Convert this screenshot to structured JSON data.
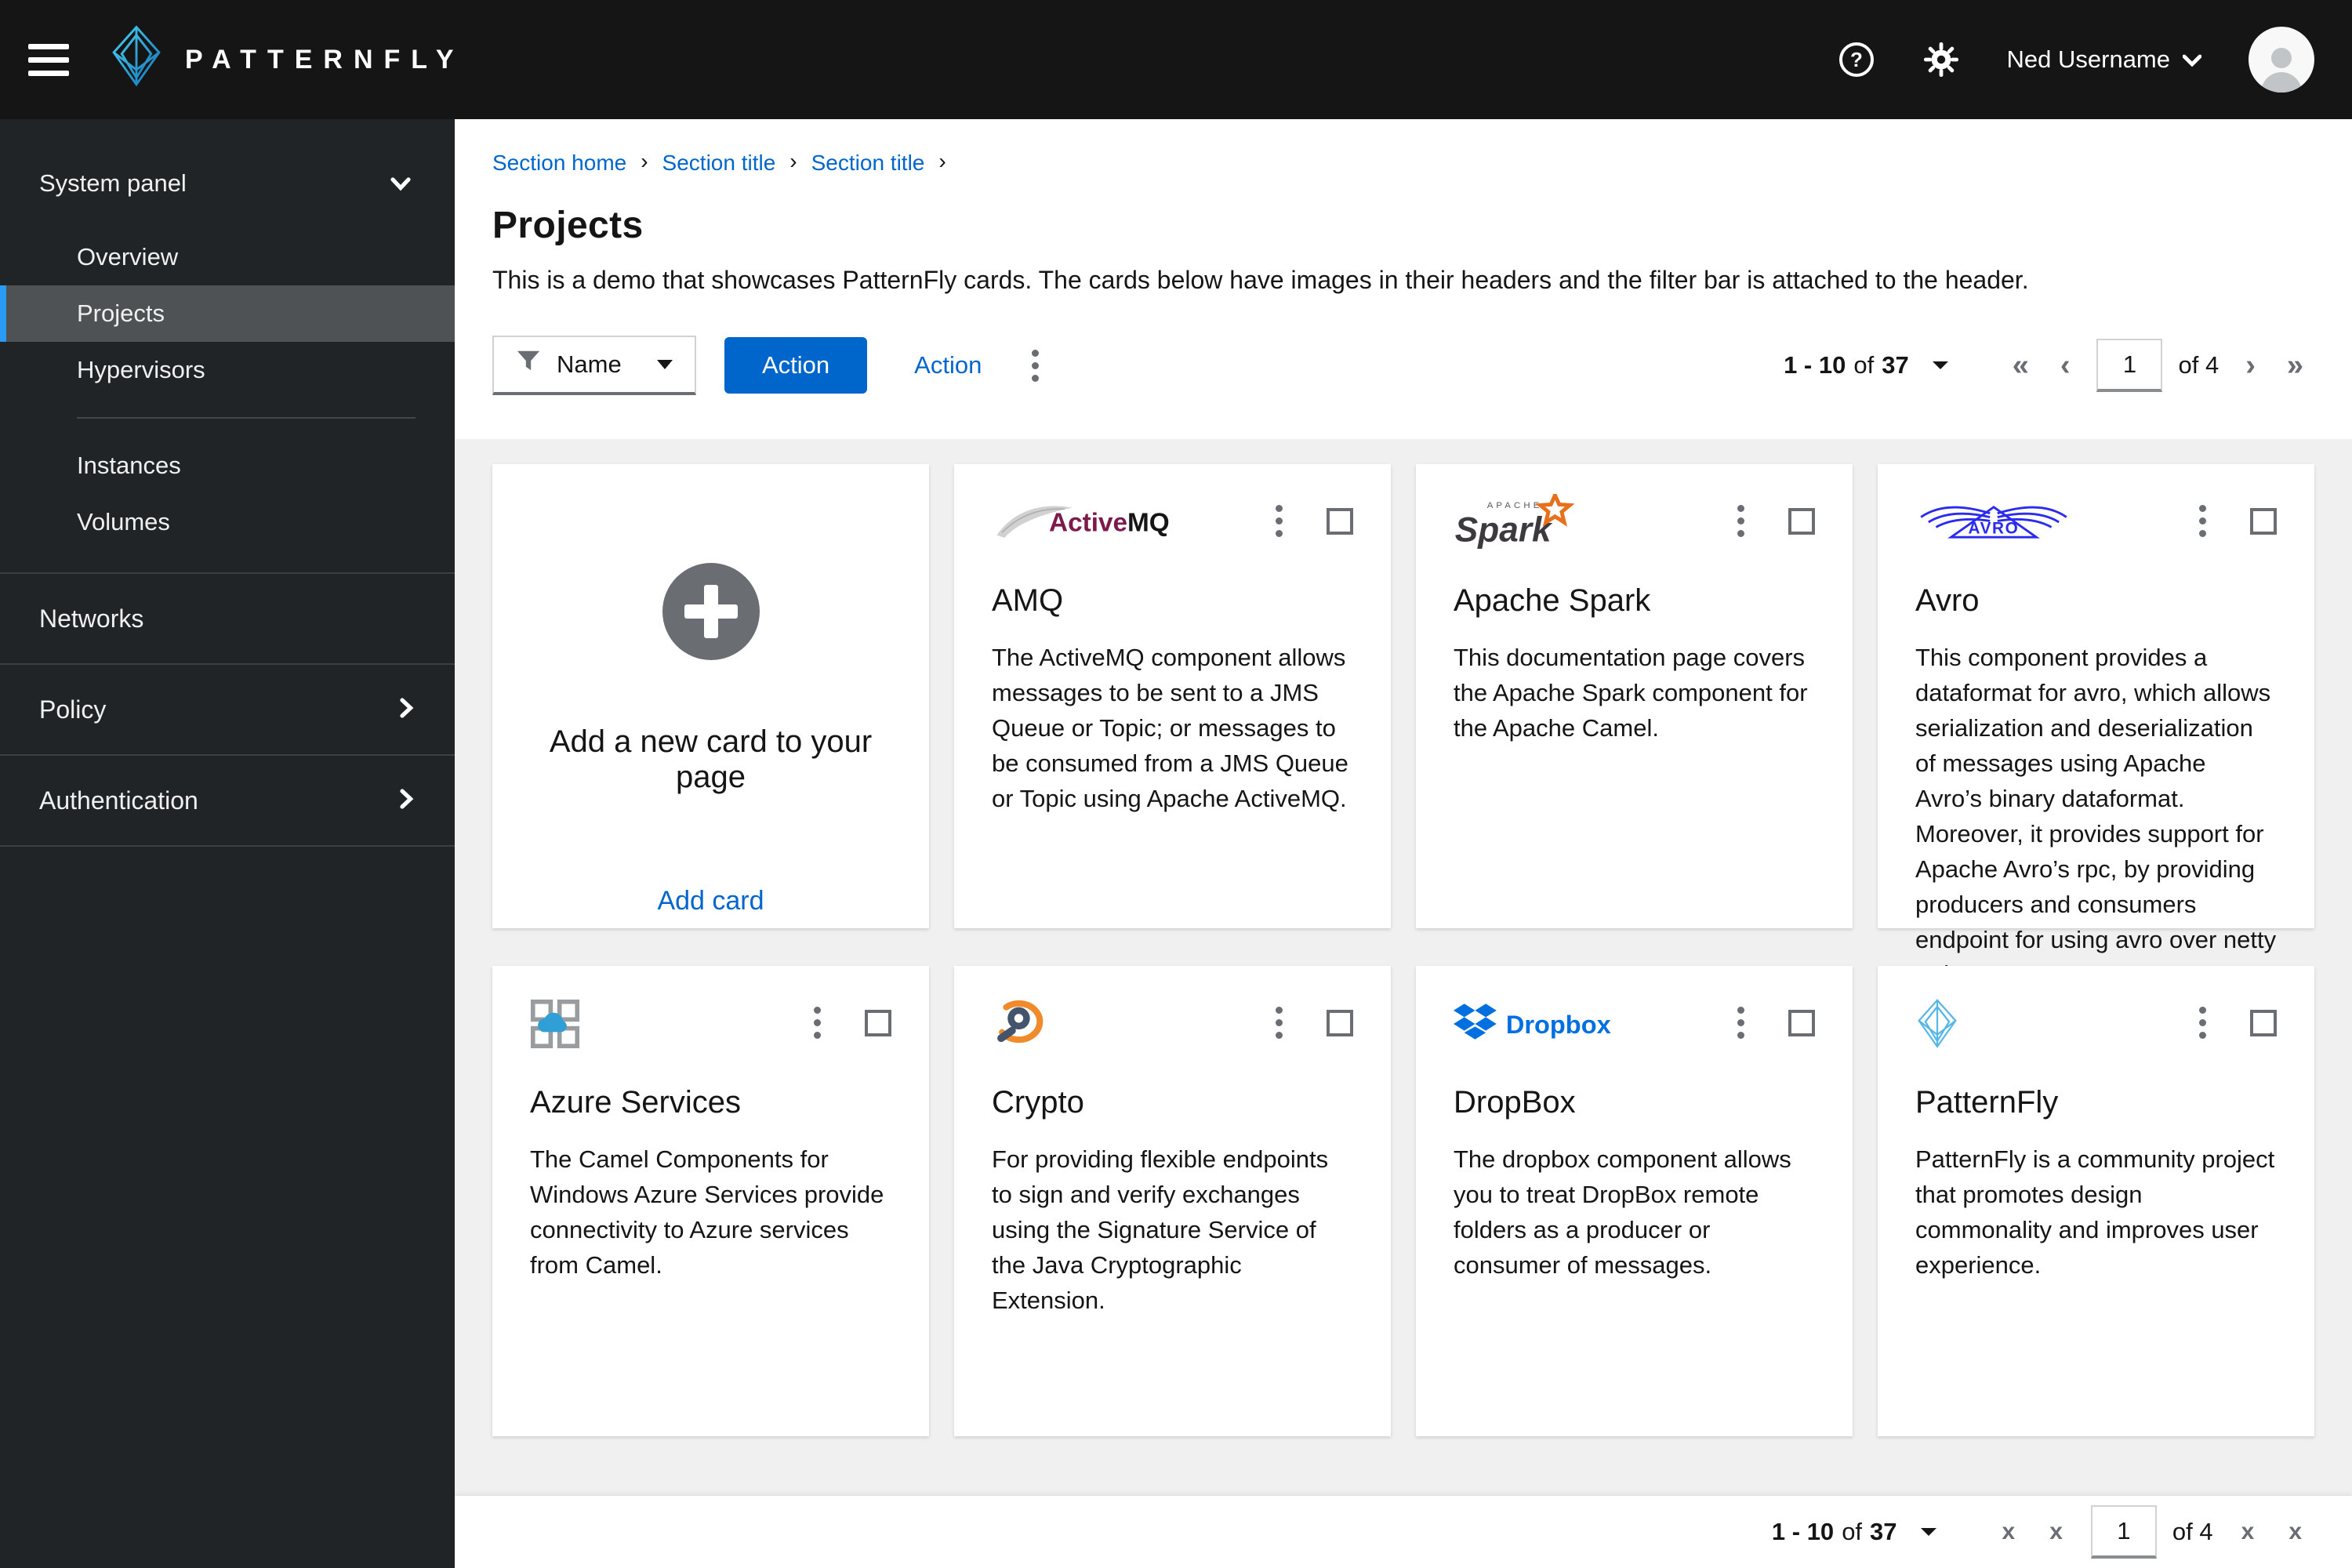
{
  "masthead": {
    "brand": "PATTERNFLY",
    "help_icon": "question-circle-icon",
    "settings_icon": "gear-icon",
    "user_name": "Ned Username"
  },
  "sidebar": {
    "section_label": "System panel",
    "items_group1": [
      {
        "label": "Overview",
        "selected": false
      },
      {
        "label": "Projects",
        "selected": true
      },
      {
        "label": "Hypervisors",
        "selected": false
      }
    ],
    "items_group2": [
      {
        "label": "Instances"
      },
      {
        "label": "Volumes"
      }
    ],
    "top_level": [
      {
        "label": "Networks",
        "expandable": false
      },
      {
        "label": "Policy",
        "expandable": true
      },
      {
        "label": "Authentication",
        "expandable": true
      }
    ]
  },
  "breadcrumb": {
    "items": [
      "Section home",
      "Section title",
      "Section title"
    ],
    "separator": "›"
  },
  "page": {
    "title": "Projects",
    "description": "This is a demo that showcases PatternFly cards. The cards below have images in their headers and the filter bar is attached to the header."
  },
  "toolbar": {
    "filter_label": "Name",
    "filter_icon": "funnel-icon",
    "primary_action_label": "Action",
    "link_action_label": "Action",
    "kebab_icon": "kebab-menu-icon"
  },
  "pagination": {
    "range": "1 - 10",
    "of_label": "of",
    "total": "37",
    "page_value": "1",
    "pages_label": "of 4",
    "first_glyph": "«",
    "prev_glyph": "‹",
    "next_glyph": "›",
    "last_glyph": "»",
    "broken_icon_glyph": "x"
  },
  "add_card": {
    "icon": "plus-circle-icon",
    "title": "Add a new card to your page",
    "link_label": "Add card"
  },
  "cards": {
    "items": [
      {
        "logo": "activemq-logo",
        "title": "AMQ",
        "description": "The ActiveMQ component allows messages to be sent to a JMS Queue or Topic; or messages to be consumed from a JMS Queue or Topic using Apache ActiveMQ."
      },
      {
        "logo": "apache-spark-logo",
        "title": "Apache Spark",
        "description": "This documentation page covers the Apache Spark component for the Apache Camel."
      },
      {
        "logo": "avro-logo",
        "title": "Avro",
        "description": "This component provides a dataformat for avro, which allows serialization and deserialization of messages using Apache Avro’s binary dataformat. Moreover, it provides support for Apache Avro’s rpc, by providing producers and consumers endpoint for using avro over netty or http."
      },
      {
        "logo": "azure-logo",
        "title": "Azure Services",
        "description": "The Camel Components for Windows Azure Services provide connectivity to Azure services from Camel."
      },
      {
        "logo": "crypto-logo",
        "title": "Crypto",
        "description": "For providing flexible endpoints to sign and verify exchanges using the Signature Service of the Java Cryptographic Extension."
      },
      {
        "logo": "dropbox-logo",
        "title": "DropBox",
        "description": "The dropbox component allows you to treat DropBox remote folders as a producer or consumer of messages."
      },
      {
        "logo": "patternfly-logo",
        "title": "PatternFly",
        "description": "PatternFly is a community project that promotes design commonality and improves user experience."
      }
    ]
  },
  "colors": {
    "primary_blue": "#0066cc",
    "nav_selected_accent": "#2b9af3",
    "masthead_bg": "#151515",
    "sidebar_bg": "#212427",
    "content_bg": "#f0f0f0"
  }
}
